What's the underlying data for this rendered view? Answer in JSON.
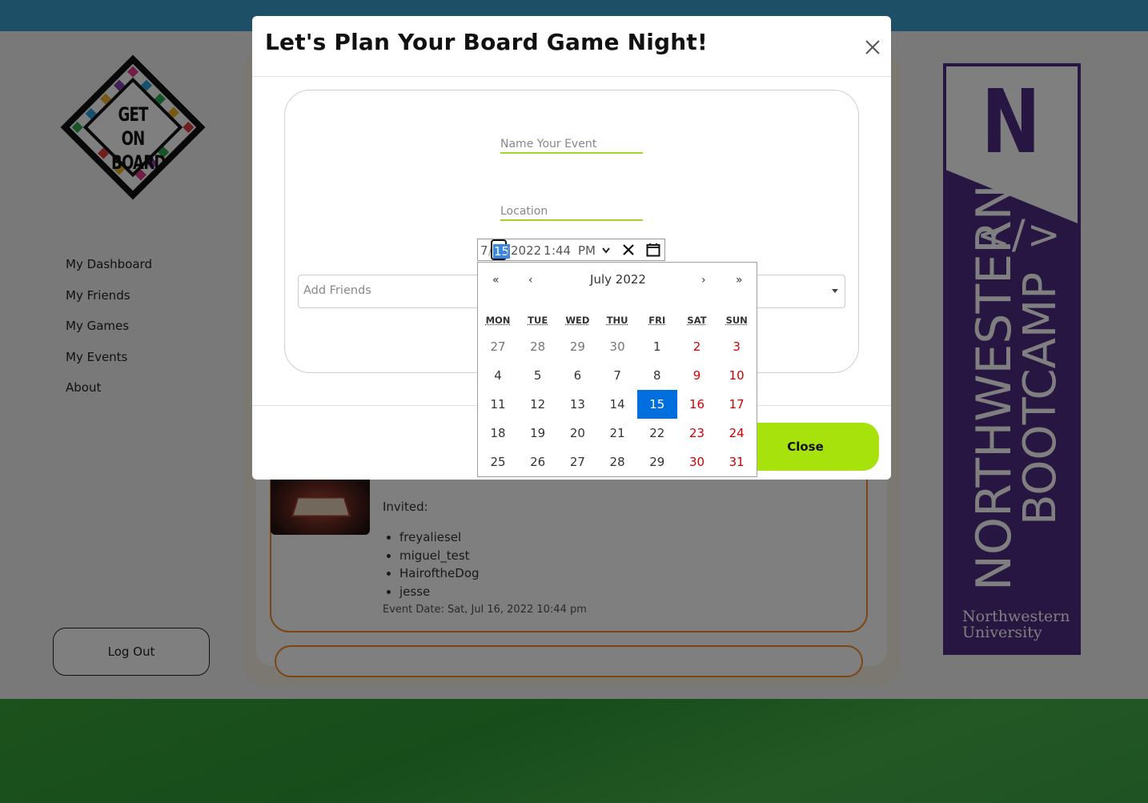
{
  "sidebar": {
    "items": [
      {
        "label": "My Dashboard"
      },
      {
        "label": "My Friends"
      },
      {
        "label": "My Games"
      },
      {
        "label": "My Events"
      },
      {
        "label": "About"
      }
    ],
    "logout_label": "Log Out"
  },
  "logo": {
    "line1": "GET ON",
    "line2": "BOARD"
  },
  "event": {
    "invited_label": "Invited:",
    "invitees": [
      "freyaliesel",
      "miguel_test",
      "HairoftheDog",
      "jesse"
    ],
    "date_text": "Event Date: Sat, Jul 16, 2022 10:44 pm"
  },
  "banner": {
    "code_symbol": "</>",
    "line1": "NORTHWESTERN",
    "line2": "BOOTCAMP",
    "university_line1": "Northwestern",
    "university_line2": "University"
  },
  "modal": {
    "title": "Let's Plan Your Board Game Night!",
    "name_placeholder": "Name Your Event",
    "location_placeholder": "Location",
    "friends_placeholder": "Add Friends",
    "close_label": "Close"
  },
  "datetime": {
    "month": "7",
    "day": "15",
    "year": "2022",
    "hour": "1",
    "minute": "44",
    "ampm": "PM"
  },
  "calendar": {
    "title": "July 2022",
    "nav": {
      "prev_year": "«",
      "prev_month": "‹",
      "next_month": "›",
      "next_year": "»"
    },
    "weekdays": [
      "MON",
      "TUE",
      "WED",
      "THU",
      "FRI",
      "SAT",
      "SUN"
    ],
    "weeks": [
      [
        "27",
        "28",
        "29",
        "30",
        "1",
        "2",
        "3"
      ],
      [
        "4",
        "5",
        "6",
        "7",
        "8",
        "9",
        "10"
      ],
      [
        "11",
        "12",
        "13",
        "14",
        "15",
        "16",
        "17"
      ],
      [
        "18",
        "19",
        "20",
        "21",
        "22",
        "23",
        "24"
      ],
      [
        "25",
        "26",
        "27",
        "28",
        "29",
        "30",
        "31"
      ]
    ],
    "selected_day": "15"
  },
  "colors": {
    "accent_green": "#a8e20c",
    "field_underline": "#a4d629",
    "card_border": "#f28c28",
    "selected_day": "#006edc",
    "weekend": "#d10000",
    "banner_purple": "#4e2a84"
  }
}
